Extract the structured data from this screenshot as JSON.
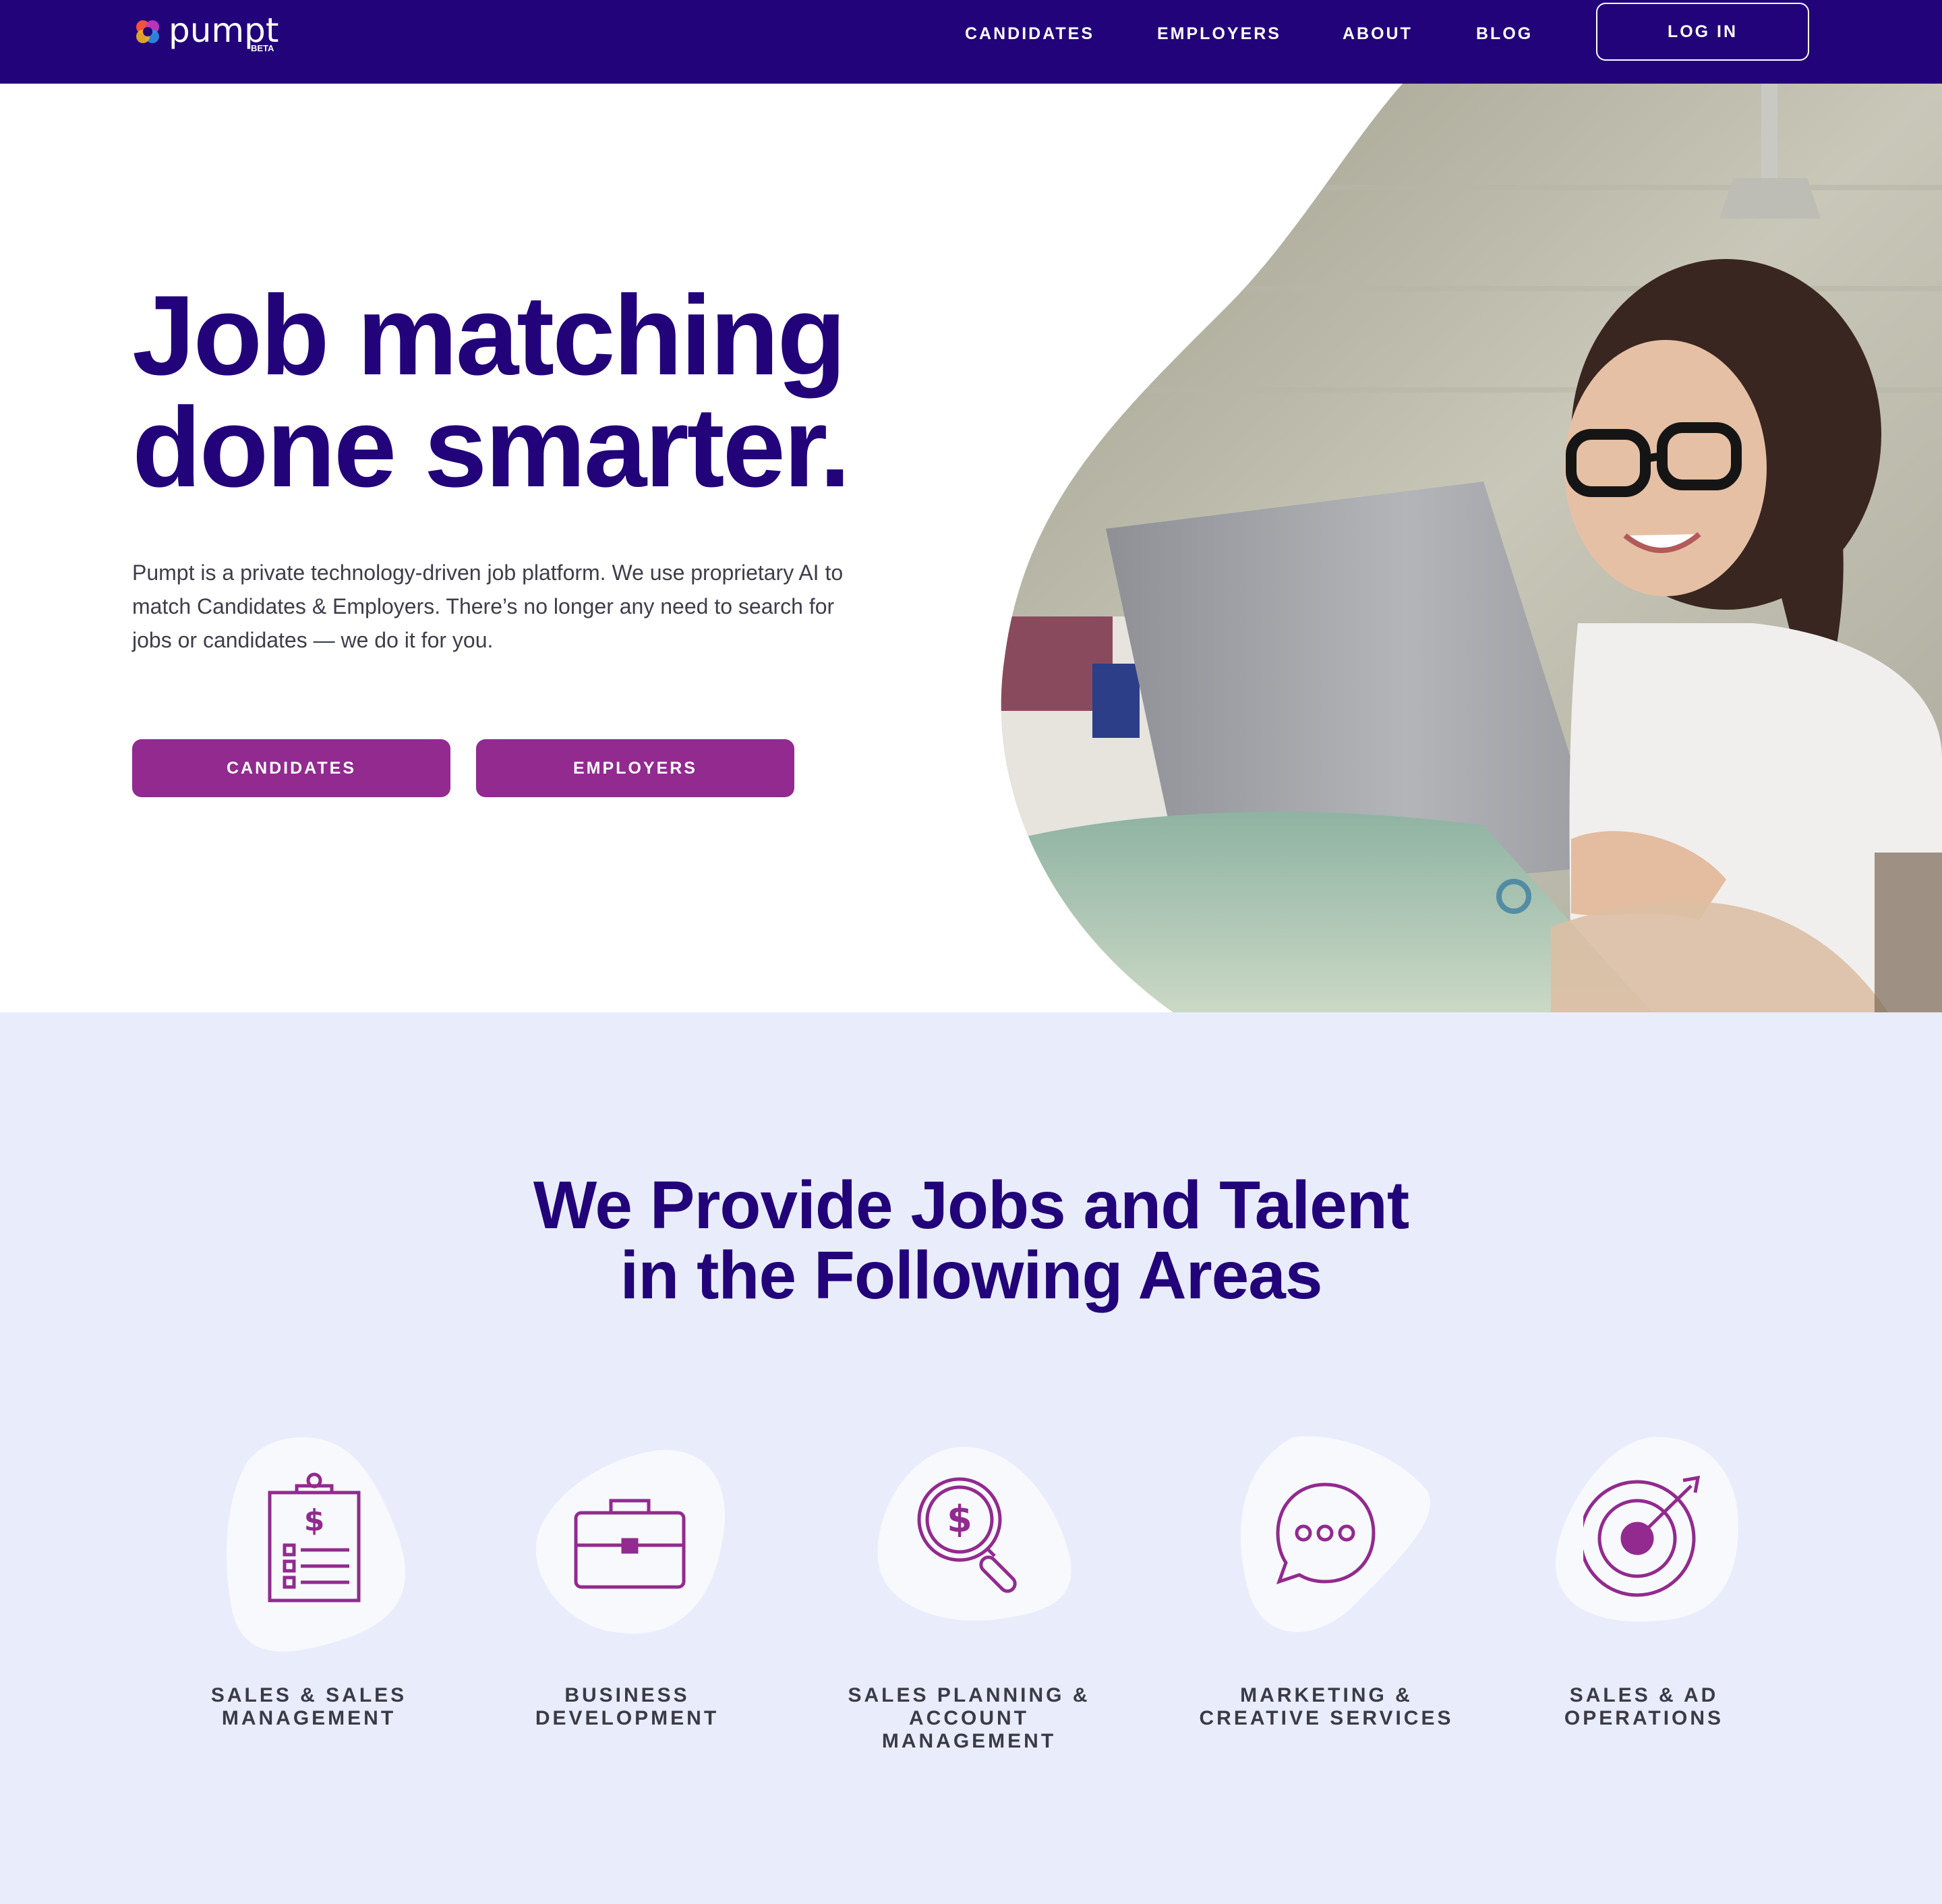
{
  "nav": {
    "logo_text": "pumpt",
    "logo_badge": "BETA",
    "links": [
      "CANDIDATES",
      "EMPLOYERS",
      "ABOUT",
      "BLOG"
    ],
    "login_label": "LOG IN"
  },
  "hero": {
    "title_line1": "Job matching",
    "title_line2": "done smarter.",
    "description": "Pumpt is a private technology-driven job platform. We use proprietary AI to match Candidates & Employers. There’s no longer any need to search for jobs or candidates — we do it for you.",
    "buttons": [
      "CANDIDATES",
      "EMPLOYERS"
    ]
  },
  "areas": {
    "title_line1": "We Provide Jobs and Talent",
    "title_line2": "in the Following Areas",
    "items": [
      {
        "label": "SALES & SALES\nMANAGEMENT",
        "icon": "clipboard-dollar-icon"
      },
      {
        "label": "BUSINESS\nDEVELOPMENT",
        "icon": "briefcase-icon"
      },
      {
        "label": "SALES PLANNING &\nACCOUNT MANAGEMENT",
        "icon": "dollar-search-icon"
      },
      {
        "label": "MARKETING &\nCREATIVE SERVICES",
        "icon": "chat-bubble-icon"
      },
      {
        "label": "SALES & AD\nOPERATIONS",
        "icon": "target-icon"
      }
    ]
  },
  "colors": {
    "nav_bg": "#22037a",
    "heading": "#22037a",
    "accent": "#922a8f",
    "section_bg": "#e9edfb",
    "blob": "#f8f9fd"
  }
}
